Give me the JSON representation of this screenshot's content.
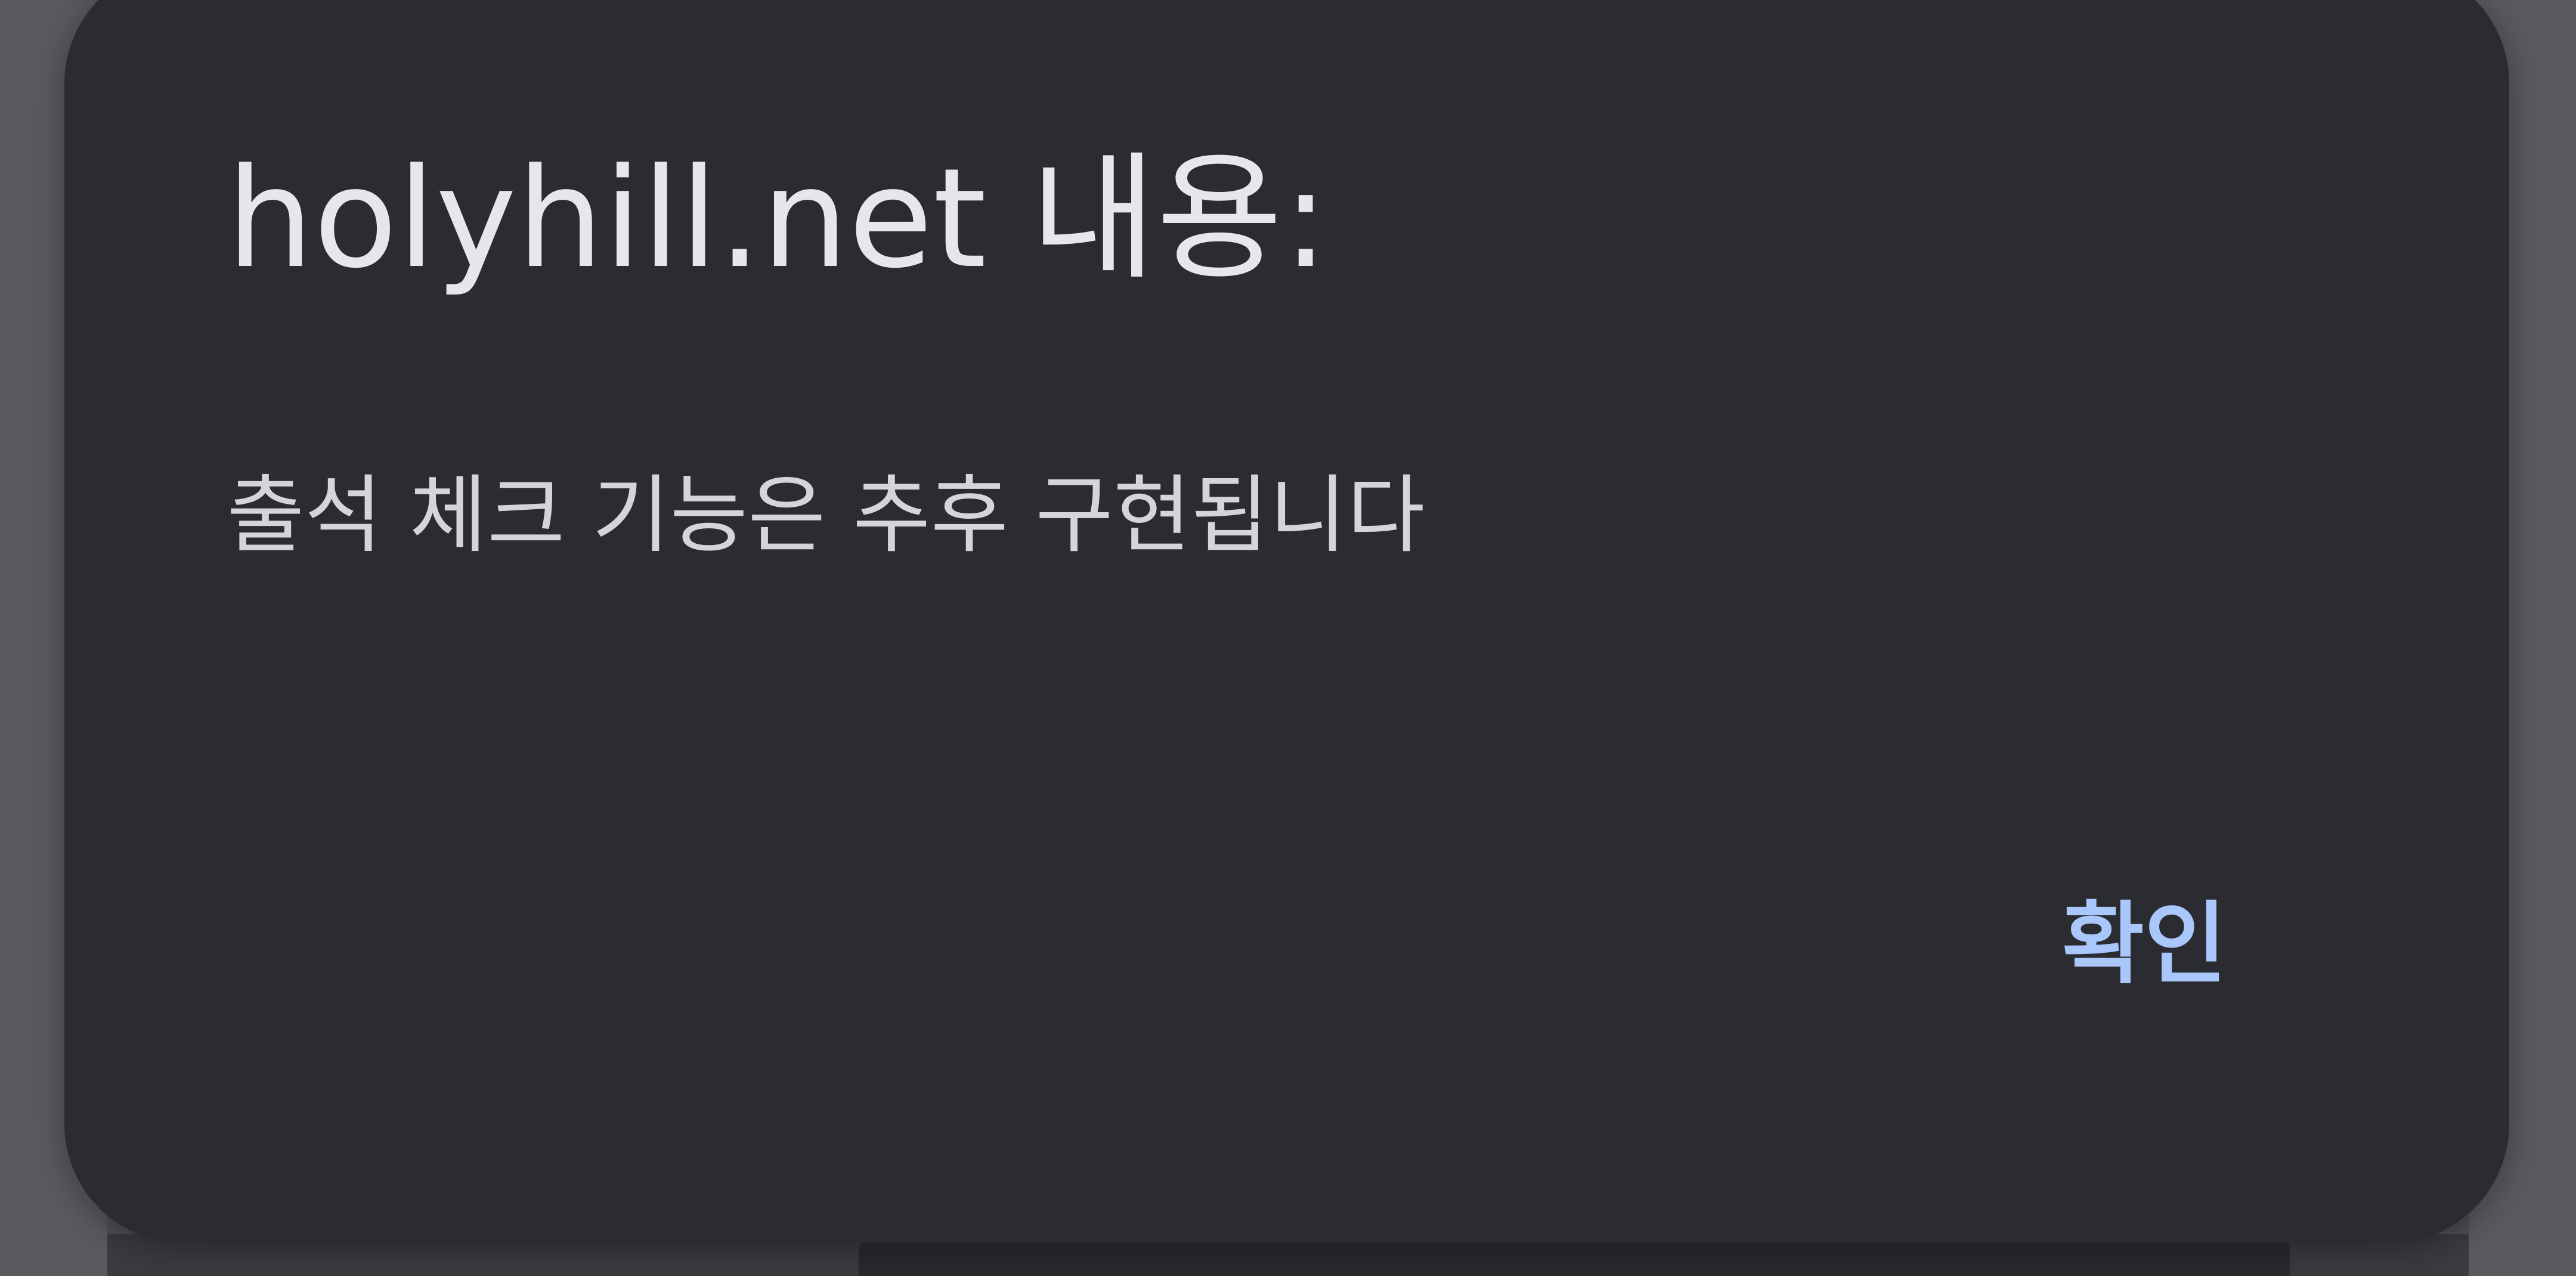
{
  "dialog": {
    "title": "holyhill.net 내용:",
    "message": "출석 체크 기능은 추후 구현됩니다",
    "confirm_label": "확인"
  },
  "colors": {
    "dialog_background": "#2b2c31",
    "title_text": "#e6e7eb",
    "message_text": "#d4d5da",
    "button_text": "#a9c7fa",
    "scrim": "#595b5f"
  }
}
